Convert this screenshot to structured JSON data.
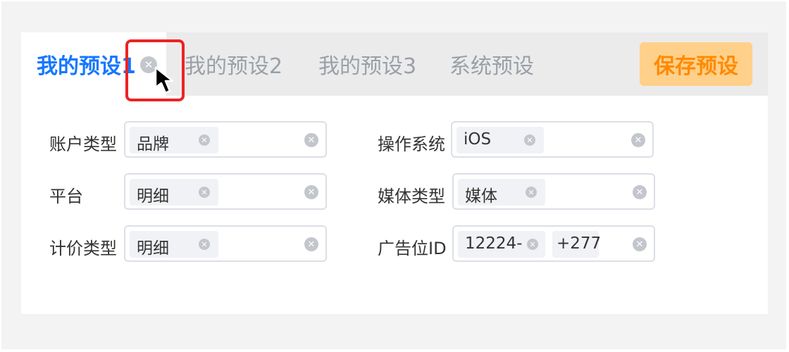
{
  "tabs": [
    {
      "label": "我的预设1",
      "active": true
    },
    {
      "label": "我的预设2",
      "active": false
    },
    {
      "label": "我的预设3",
      "active": false
    },
    {
      "label": "系统预设",
      "active": false
    }
  ],
  "tab_close_icon": "close-circle-icon",
  "save_button": {
    "label": "保存预设"
  },
  "colors": {
    "accent": "#1677ff",
    "save_bg": "#ffd08a",
    "save_text": "#ff8a00",
    "highlight": "#ee2222"
  },
  "filters": {
    "account_type": {
      "label": "账户类型",
      "tags": [
        "品牌"
      ]
    },
    "platform": {
      "label": "平台",
      "tags": [
        "明细"
      ]
    },
    "pricing_type": {
      "label": "计价类型",
      "tags": [
        "明细"
      ]
    },
    "os": {
      "label": "操作系统",
      "tags": [
        "iOS"
      ]
    },
    "media_type": {
      "label": "媒体类型",
      "tags": [
        "媒体"
      ]
    },
    "ad_slot": {
      "label": "广告位ID",
      "tags": [
        "12224-"
      ],
      "more": "+277"
    }
  }
}
